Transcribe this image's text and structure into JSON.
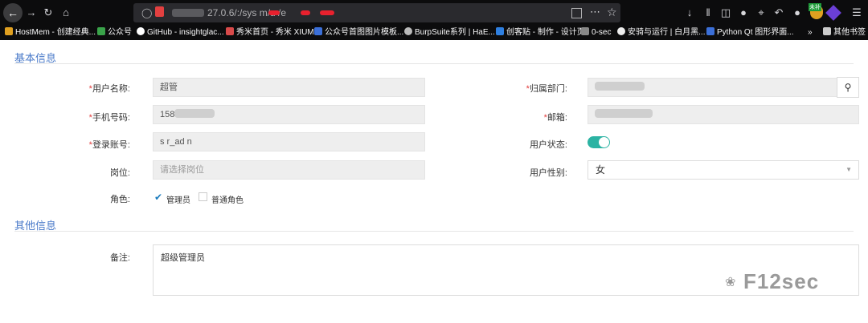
{
  "browser": {
    "url_visible": "27.0.6/:/sys m/u  /e",
    "toolbar_icons": [
      "back-icon",
      "forward-icon",
      "reload-icon",
      "home-icon",
      "shield-icon",
      "lock-icon",
      "qr-icon",
      "more-icon",
      "star-icon",
      "download-icon",
      "library-icon",
      "sidebar-icon",
      "account-icon",
      "crop-icon",
      "undo-icon",
      "extension-icon",
      "menu-icon"
    ],
    "ext_badge": "未补"
  },
  "bookmarks": [
    {
      "label": "HostMem - 创建经典...",
      "color": "#e0a020"
    },
    {
      "label": "公众号",
      "color": "#3aa34a"
    },
    {
      "label": "GitHub - insightglac...",
      "color": "#ffffff"
    },
    {
      "label": "秀米首页 - 秀米 XIUMI",
      "color": "#d84a4a"
    },
    {
      "label": "公众号首图图片模板...",
      "color": "#3b6fd8"
    },
    {
      "label": "BurpSuite系列 | HaE...",
      "color": "#bbbbbb"
    },
    {
      "label": "创客贴 - 制作 - 设计页",
      "color": "#2e7fe0"
    },
    {
      "label": "0-sec",
      "color": "#888888"
    },
    {
      "label": "安骑与运行 | 白月黑...",
      "color": "#eeeeee"
    },
    {
      "label": "Python Qt 图形界面...",
      "color": "#3b6fd8"
    },
    {
      "label": "其他书签",
      "color": "#cccccc"
    }
  ],
  "form": {
    "section_basic": "基本信息",
    "section_other": "其他信息",
    "username_label": "用户名称:",
    "username_value": "超管",
    "dept_label": "归属部门:",
    "phone_label": "手机号码:",
    "phone_value": "158",
    "email_label": "邮箱:",
    "account_label": "登录账号:",
    "account_value": "s   r_ad  n",
    "status_label": "用户状态:",
    "status_enabled": true,
    "post_label": "岗位:",
    "post_placeholder": "请选择岗位",
    "gender_label": "用户性别:",
    "gender_value": "女",
    "role_label": "角色:",
    "roles": [
      {
        "label": "管理员",
        "checked": true
      },
      {
        "label": "普通角色",
        "checked": false
      }
    ],
    "remark_label": "备注:",
    "remark_value": "超级管理员",
    "required_mark": "*"
  },
  "watermark": "F12sec"
}
